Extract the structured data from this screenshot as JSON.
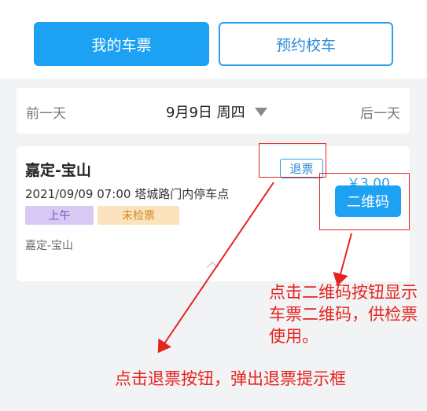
{
  "tabs": {
    "mine_label": "我的车票",
    "book_label": "预约校车"
  },
  "date_nav": {
    "prev_label": "前一天",
    "current_date": "9月9日 周四",
    "next_label": "后一天"
  },
  "ticket": {
    "route": "嘉定-宝山",
    "datetime_location": "2021/09/09 07:00 塔城路门内停车点",
    "period_badge": "上午",
    "status_badge": "未检票",
    "route_sub": "嘉定-宝山",
    "price": "￥3.00",
    "refund_label": "退票",
    "qr_label": "二维码"
  },
  "annotations": {
    "qr_note": "点击二维码按钮显示车票二维码，供检票使用。",
    "refund_note": "点击退票按钮，弹出退票提示框"
  },
  "colors": {
    "accent": "#1da1f2",
    "annotation": "#e6231f",
    "badge_am_bg": "#d8c8f4",
    "badge_status_bg": "#fbe3bd"
  }
}
